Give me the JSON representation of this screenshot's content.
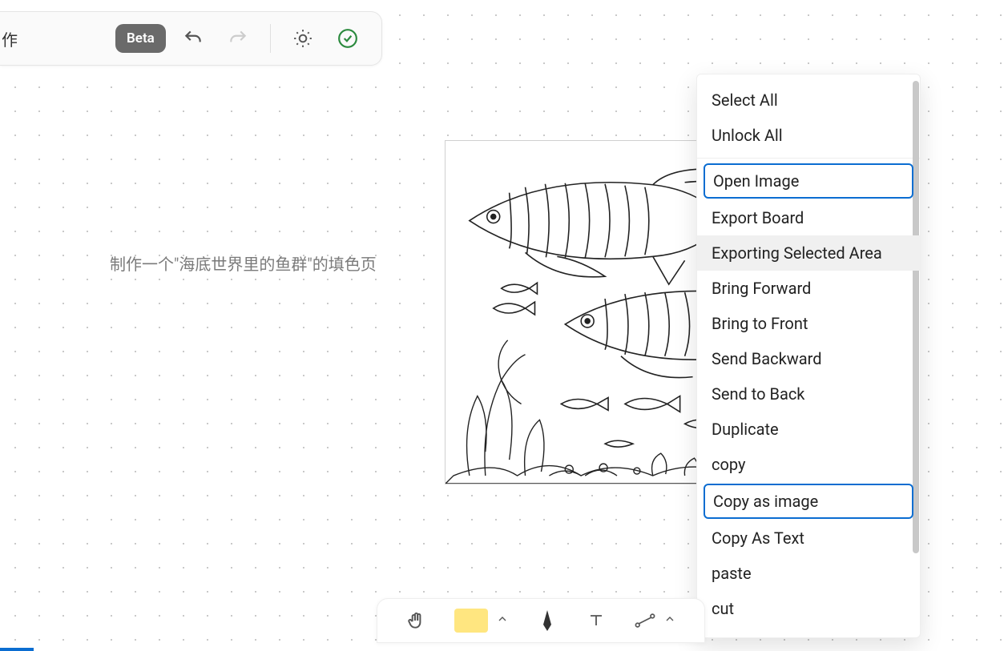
{
  "toolbar": {
    "partial_text": "作",
    "beta_label": "Beta"
  },
  "canvas": {
    "prompt_text": "制作一个\"海底世界里的鱼群\"的填色页"
  },
  "context_menu": {
    "items": [
      {
        "label": "Select All",
        "framed": false
      },
      {
        "label": "Unlock All",
        "framed": false,
        "sep_after": true
      },
      {
        "label": "Open Image",
        "framed": true
      },
      {
        "label": "Export Board",
        "framed": false
      },
      {
        "label": "Exporting Selected Area",
        "framed": false,
        "hover": true
      },
      {
        "label": "Bring Forward",
        "framed": false
      },
      {
        "label": "Bring to Front",
        "framed": false
      },
      {
        "label": "Send Backward",
        "framed": false
      },
      {
        "label": "Send to Back",
        "framed": false
      },
      {
        "label": "Duplicate",
        "framed": false
      },
      {
        "label": "copy",
        "framed": false
      },
      {
        "label": "Copy as image",
        "framed": true
      },
      {
        "label": "Copy As Text",
        "framed": false
      },
      {
        "label": "paste",
        "framed": false
      },
      {
        "label": "cut",
        "framed": false
      }
    ]
  },
  "bottom_tray": {
    "tools": [
      "hand",
      "sticky",
      "pen",
      "text",
      "connector"
    ]
  }
}
